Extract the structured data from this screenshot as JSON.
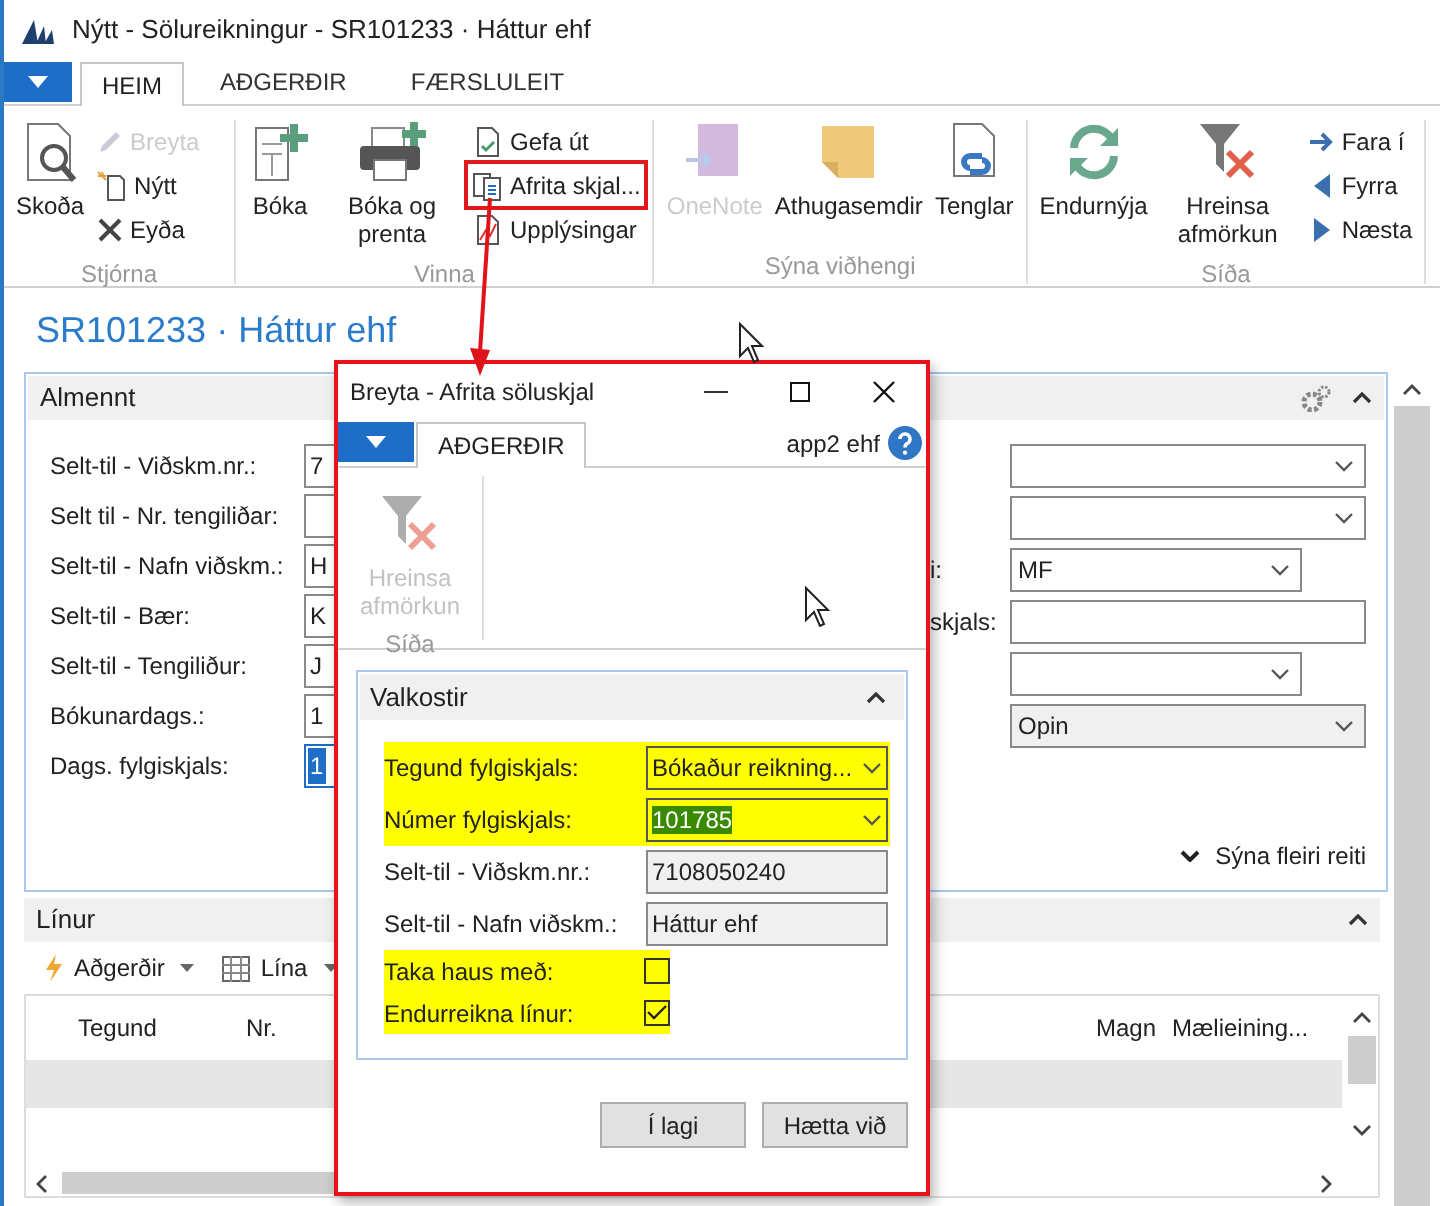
{
  "window": {
    "title": "Nýtt - Sölureikningur - SR101233 · Háttur ehf"
  },
  "tabs": [
    {
      "label": "HEIM",
      "selected": true
    },
    {
      "label": "AÐGERÐIR",
      "selected": false
    },
    {
      "label": "FÆRSLULEIT",
      "selected": false
    }
  ],
  "ribbon": {
    "groups": [
      {
        "label": "Stjórna",
        "items": [
          {
            "label": "Skoða",
            "kind": "large",
            "disabled": false,
            "annotated": false
          },
          {
            "label": "Breyta",
            "kind": "small",
            "disabled": true,
            "annotated": false
          },
          {
            "label": "Nýtt",
            "kind": "small",
            "disabled": false,
            "annotated": false
          },
          {
            "label": "Eyða",
            "kind": "small",
            "disabled": false,
            "annotated": false
          }
        ]
      },
      {
        "label": "Vinna",
        "items": [
          {
            "label": "Bóka",
            "kind": "large",
            "disabled": false,
            "annotated": false
          },
          {
            "label": "Bóka og prenta",
            "kind": "large",
            "disabled": false,
            "annotated": false
          },
          {
            "label": "Gefa út",
            "kind": "small",
            "disabled": false,
            "annotated": false
          },
          {
            "label": "Afrita skjal...",
            "kind": "small",
            "disabled": false,
            "annotated": true
          },
          {
            "label": "Upplýsingar",
            "kind": "small",
            "disabled": false,
            "annotated": false
          }
        ]
      },
      {
        "label": "Sýna viðhengi",
        "items": [
          {
            "label": "OneNote",
            "kind": "large",
            "disabled": true,
            "annotated": false
          },
          {
            "label": "Athugasemdir",
            "kind": "large",
            "disabled": false,
            "annotated": false
          },
          {
            "label": "Tenglar",
            "kind": "large",
            "disabled": false,
            "annotated": false
          }
        ]
      },
      {
        "label": "Síða",
        "items": [
          {
            "label": "Endurnýja",
            "kind": "large",
            "disabled": false,
            "annotated": false
          },
          {
            "label": "Hreinsa afmörkun",
            "kind": "large",
            "disabled": false,
            "annotated": false
          },
          {
            "label": "Fara í",
            "kind": "small",
            "disabled": false,
            "annotated": false
          },
          {
            "label": "Fyrra",
            "kind": "small",
            "disabled": false,
            "annotated": false
          },
          {
            "label": "Næsta",
            "kind": "small",
            "disabled": false,
            "annotated": false
          }
        ]
      }
    ]
  },
  "page_title": "SR101233 · Háttur ehf",
  "general": {
    "title": "Almennt",
    "fields": [
      {
        "label": "Selt-til - Viðskm.nr.:",
        "value": "7",
        "focused": false
      },
      {
        "label": "Selt til - Nr. tengiliðar:",
        "focused": false
      },
      {
        "label": "Selt-til - Nafn viðskm.:",
        "value": "H",
        "focused": false
      },
      {
        "label": "Selt-til - Bær:",
        "value": "K",
        "focused": false
      },
      {
        "label": "Selt-til - Tengiliður:",
        "value": "J",
        "focused": false
      },
      {
        "label": "Bókunardags.:",
        "value": "1",
        "focused": false
      },
      {
        "label": "Dags. fylgiskjals:",
        "value": "1",
        "focused": true
      }
    ],
    "right_fields": [
      {
        "kind": "dropdown",
        "readonly": false
      },
      {
        "kind": "dropdown",
        "readonly": false
      },
      {
        "label": "i:",
        "kind": "short_dropdown",
        "value": "MF",
        "readonly": false
      },
      {
        "label": "skjals:",
        "kind": "text",
        "readonly": false
      },
      {
        "kind": "short_dropdown",
        "readonly": false
      },
      {
        "kind": "dropdown",
        "value": "Opin",
        "readonly": true
      }
    ],
    "show_more": "Sýna fleiri reiti"
  },
  "lines": {
    "title": "Línur",
    "actions": [
      "Aðgerðir",
      "Lína"
    ],
    "columns": [
      "Tegund",
      "Nr.",
      "Magn",
      "Mælieining..."
    ]
  },
  "dialog": {
    "title": "Breyta - Afrita söluskjal",
    "tabs": [
      {
        "label": "AÐGERÐIR",
        "selected": true
      }
    ],
    "company": "app2 ehf",
    "ribbon": {
      "group": "Síða",
      "items": [
        {
          "label": "Hreinsa afmörkun",
          "disabled": true
        }
      ]
    },
    "options": {
      "title": "Valkostir",
      "rows": [
        {
          "kind": "dropdown",
          "label": "Tegund fylgiskjals:",
          "value": "Bókaður reikning...",
          "highlighted": true,
          "value_selected": false
        },
        {
          "kind": "dropdown",
          "label": "Númer fylgiskjals:",
          "value": "101785",
          "highlighted": true,
          "value_selected": true
        },
        {
          "kind": "readonly",
          "label": "Selt-til - Viðskm.nr.:",
          "value": "7108050240",
          "highlighted": false,
          "value_selected": false
        },
        {
          "kind": "readonly",
          "label": "Selt-til - Nafn viðskm.:",
          "value": "Háttur ehf",
          "highlighted": false,
          "value_selected": false
        },
        {
          "kind": "checkbox",
          "label": "Taka haus með:",
          "checked": false,
          "highlighted": true
        },
        {
          "kind": "checkbox",
          "label": "Endurreikna línur:",
          "checked": true,
          "highlighted": true
        }
      ]
    },
    "buttons": [
      "Í lagi",
      "Hætta við"
    ]
  }
}
